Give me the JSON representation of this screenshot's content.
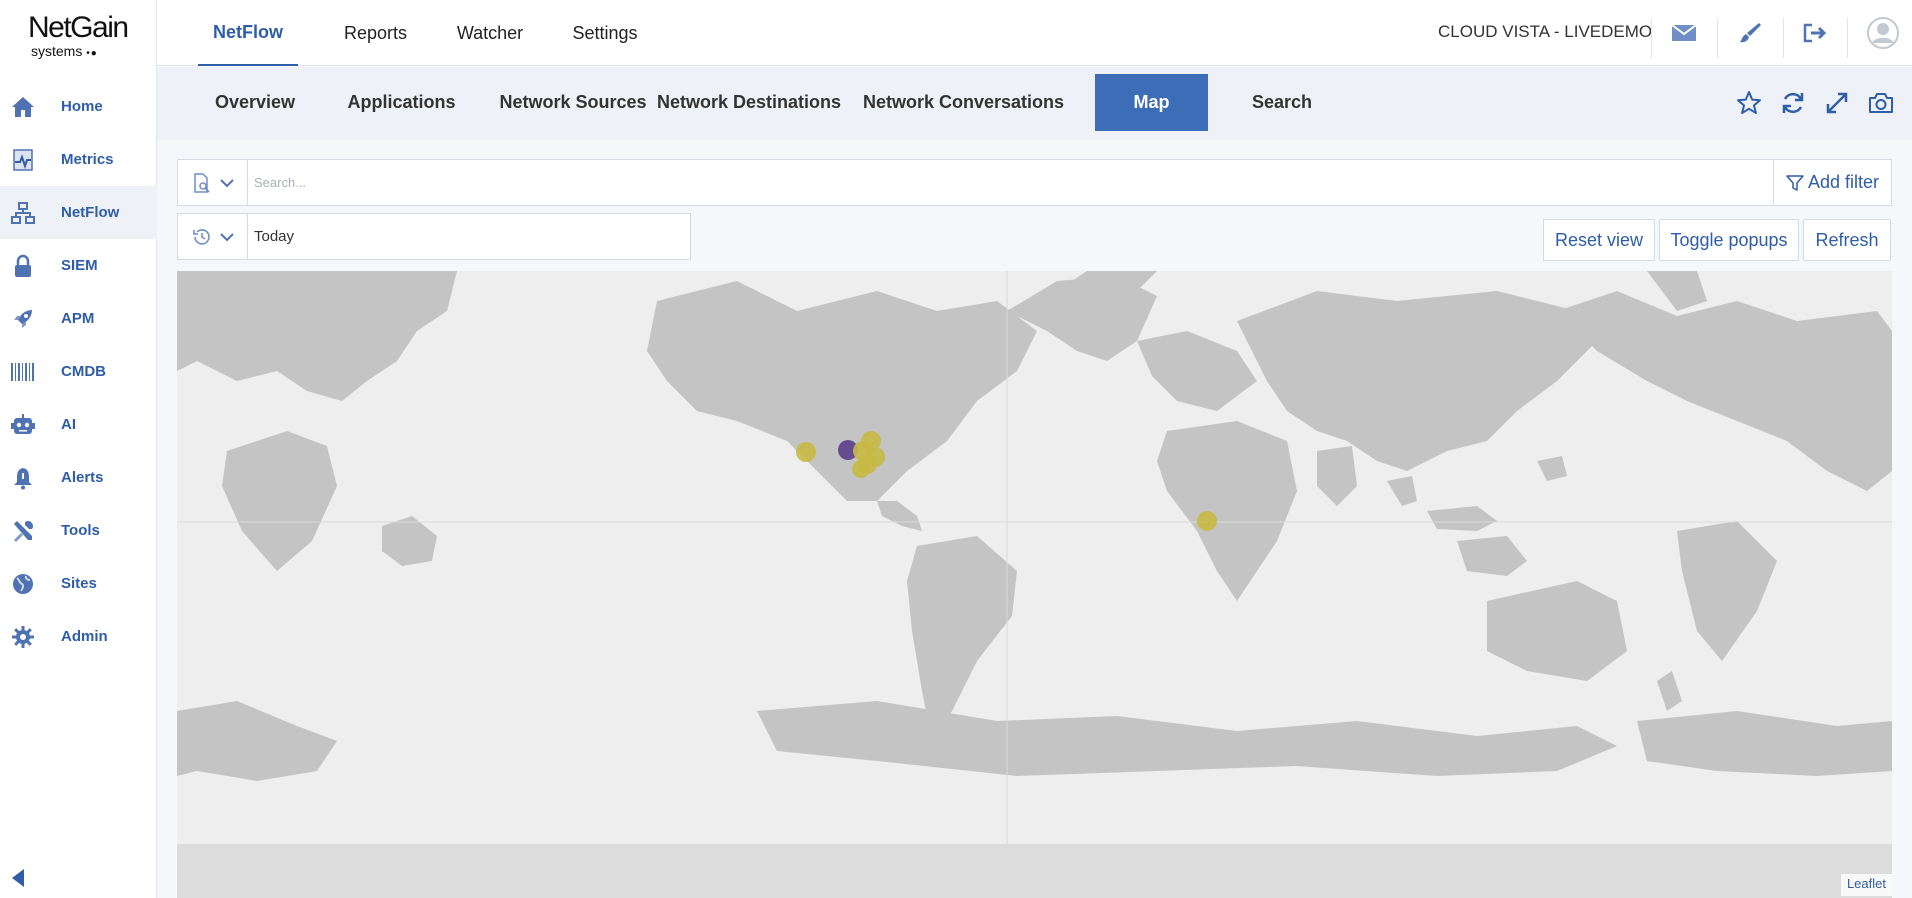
{
  "brand": {
    "name": "NetGain",
    "sub": "systems",
    "dots": "•●"
  },
  "sidebar": {
    "items": [
      {
        "label": "Home",
        "icon": "home-icon"
      },
      {
        "label": "Metrics",
        "icon": "metrics-icon"
      },
      {
        "label": "NetFlow",
        "icon": "netflow-icon"
      },
      {
        "label": "SIEM",
        "icon": "lock-icon"
      },
      {
        "label": "APM",
        "icon": "rocket-icon"
      },
      {
        "label": "CMDB",
        "icon": "barcode-icon"
      },
      {
        "label": "AI",
        "icon": "robot-icon"
      },
      {
        "label": "Alerts",
        "icon": "bell-icon"
      },
      {
        "label": "Tools",
        "icon": "tools-icon"
      },
      {
        "label": "Sites",
        "icon": "globe-icon"
      },
      {
        "label": "Admin",
        "icon": "gear-icon"
      }
    ],
    "active": "NetFlow"
  },
  "topnav": {
    "tabs": [
      {
        "label": "NetFlow"
      },
      {
        "label": "Reports"
      },
      {
        "label": "Watcher"
      },
      {
        "label": "Settings"
      }
    ],
    "active": "NetFlow",
    "org": "CLOUD VISTA - LIVEDEMO"
  },
  "subnav": {
    "tabs": [
      {
        "label": "Overview"
      },
      {
        "label": "Applications"
      },
      {
        "label": "Network Sources"
      },
      {
        "label": "Network Destinations"
      },
      {
        "label": "Network Conversations"
      },
      {
        "label": "Map"
      },
      {
        "label": "Search"
      }
    ],
    "active": "Map"
  },
  "search": {
    "placeholder": "Search...",
    "value": "",
    "add_filter": "Add filter"
  },
  "time": {
    "value": "Today"
  },
  "map_buttons": {
    "reset": "Reset view",
    "toggle": "Toggle popups",
    "refresh": "Refresh"
  },
  "map": {
    "attribution": "Leaflet",
    "colors": {
      "ocean": "#eeeeee",
      "land": "#c4c4c4",
      "yellow": "#c8b945",
      "purple": "#5b3f8c"
    }
  }
}
